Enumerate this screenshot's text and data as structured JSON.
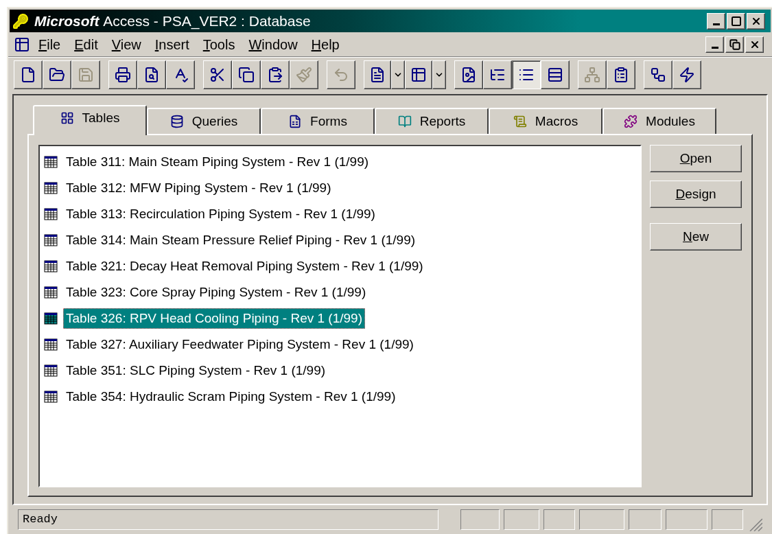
{
  "window": {
    "brand": "Microsoft",
    "title": "Access - PSA_VER2 : Database"
  },
  "menu": [
    {
      "label": "File"
    },
    {
      "label": "Edit"
    },
    {
      "label": "View"
    },
    {
      "label": "Insert"
    },
    {
      "label": "Tools"
    },
    {
      "label": "Window"
    },
    {
      "label": "Help"
    }
  ],
  "toolbar": [
    {
      "kind": "button",
      "disabled": false,
      "selected": false
    },
    {
      "kind": "button",
      "disabled": false,
      "selected": false
    },
    {
      "kind": "button",
      "disabled": true,
      "selected": false
    },
    {
      "kind": "separator"
    },
    {
      "kind": "button",
      "disabled": false,
      "selected": false
    },
    {
      "kind": "button",
      "disabled": false,
      "selected": false
    },
    {
      "kind": "button",
      "disabled": false,
      "selected": false
    },
    {
      "kind": "separator"
    },
    {
      "kind": "button",
      "disabled": false,
      "selected": false
    },
    {
      "kind": "button",
      "disabled": false,
      "selected": false
    },
    {
      "kind": "button",
      "disabled": false,
      "selected": false
    },
    {
      "kind": "button",
      "disabled": true,
      "selected": false
    },
    {
      "kind": "separator"
    },
    {
      "kind": "button",
      "disabled": true,
      "selected": false
    },
    {
      "kind": "separator"
    },
    {
      "kind": "dropdown",
      "disabled": false,
      "selected": false
    },
    {
      "kind": "dropdown",
      "disabled": false,
      "selected": false
    },
    {
      "kind": "separator"
    },
    {
      "kind": "button",
      "disabled": false,
      "selected": false
    },
    {
      "kind": "button",
      "disabled": false,
      "selected": false
    },
    {
      "kind": "button",
      "disabled": false,
      "selected": true
    },
    {
      "kind": "button",
      "disabled": false,
      "selected": false
    },
    {
      "kind": "separator"
    },
    {
      "kind": "button",
      "disabled": true,
      "selected": false
    },
    {
      "kind": "button",
      "disabled": false,
      "selected": false
    },
    {
      "kind": "separator"
    },
    {
      "kind": "button",
      "disabled": false,
      "selected": false
    },
    {
      "kind": "button",
      "disabled": false,
      "selected": false
    }
  ],
  "tabs": [
    {
      "label": "Tables",
      "selected": true
    },
    {
      "label": "Queries",
      "selected": false
    },
    {
      "label": "Forms",
      "selected": false
    },
    {
      "label": "Reports",
      "selected": false
    },
    {
      "label": "Macros",
      "selected": false
    },
    {
      "label": "Modules",
      "selected": false
    }
  ],
  "objects": [
    {
      "name": "Table 311: Main Steam Piping System - Rev 1 (1/99)",
      "selected": false
    },
    {
      "name": "Table 312: MFW Piping System - Rev 1 (1/99)",
      "selected": false
    },
    {
      "name": "Table 313: Recirculation Piping System - Rev 1 (1/99)",
      "selected": false
    },
    {
      "name": "Table 314: Main Steam Pressure Relief Piping - Rev 1 (1/99)",
      "selected": false
    },
    {
      "name": "Table 321: Decay Heat Removal Piping System - Rev 1 (1/99)",
      "selected": false
    },
    {
      "name": "Table 323: Core Spray Piping System - Rev 1 (1/99)",
      "selected": false
    },
    {
      "name": "Table 326: RPV Head Cooling Piping - Rev 1 (1/99)",
      "selected": true
    },
    {
      "name": "Table 327: Auxiliary Feedwater Piping System - Rev 1 (1/99)",
      "selected": false
    },
    {
      "name": "Table 351: SLC Piping System - Rev 1 (1/99)",
      "selected": false
    },
    {
      "name": "Table 354: Hydraulic Scram Piping System - Rev 1 (1/99)",
      "selected": false
    }
  ],
  "buttons": [
    {
      "label": "Open"
    },
    {
      "label": "Design"
    },
    {
      "label": "New"
    }
  ],
  "status_bar": {
    "text": "Ready"
  }
}
